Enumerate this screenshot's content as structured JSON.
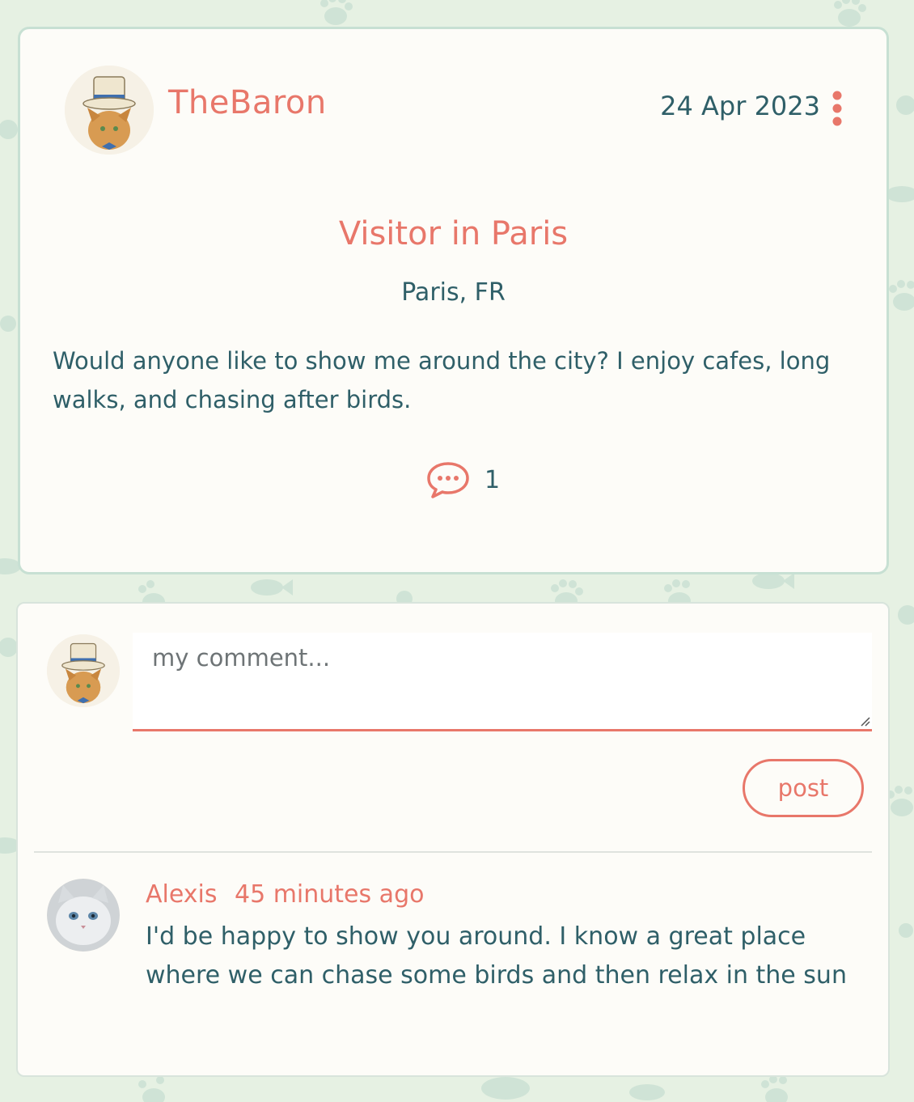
{
  "post": {
    "author": "TheBaron",
    "date": "24 Apr 2023",
    "title": "Visitor in Paris",
    "location": "Paris, FR",
    "body": "Would anyone like to show me around the city? I enjoy cafes, long walks, and chasing after birds.",
    "comment_count": "1",
    "icons": {
      "more": "more-vertical-icon",
      "comments": "comment-bubble-icon"
    }
  },
  "comment_form": {
    "placeholder": "my comment...",
    "value": "",
    "submit_label": "post"
  },
  "comments": [
    {
      "author": "Alexis",
      "time": "45 minutes ago",
      "text": "I'd be happy to show you around. I know a great place where we can chase some birds and then relax in the sun"
    }
  ],
  "colors": {
    "accent": "#e8776a",
    "text": "#2f5f68",
    "background": "#e6f1e3",
    "card": "#fdfcf8",
    "pattern": "#cfe3d6"
  }
}
